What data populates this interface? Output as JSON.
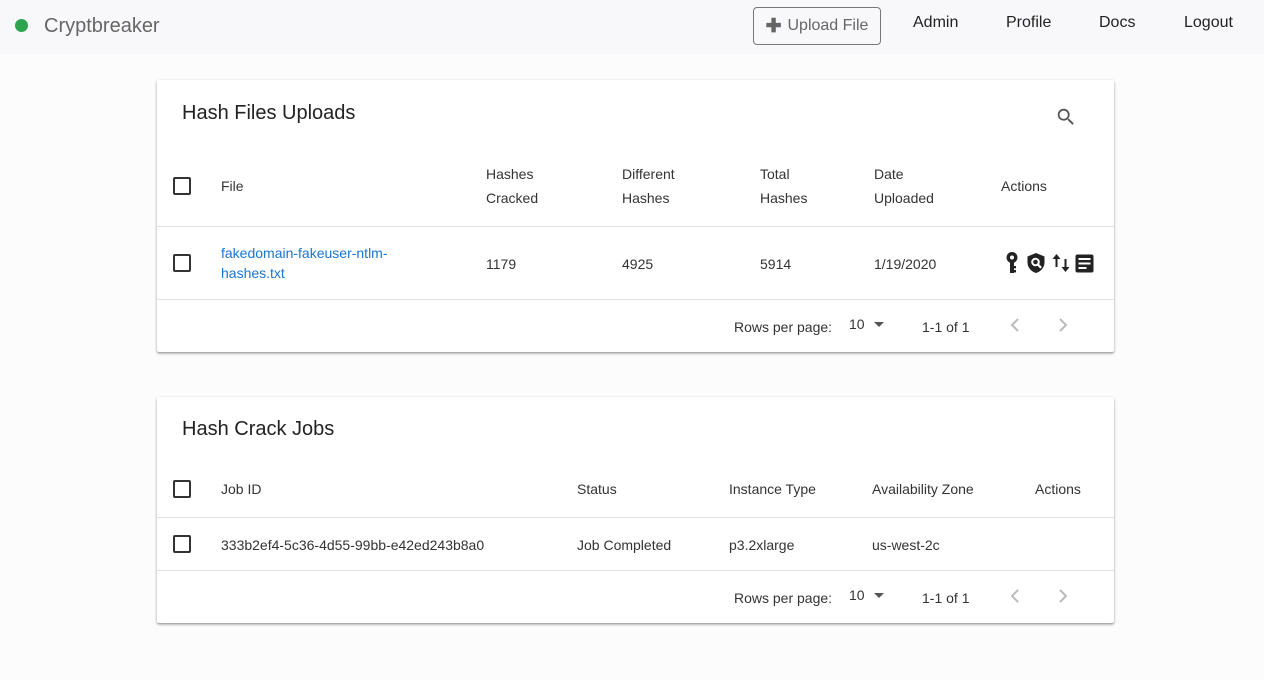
{
  "nav": {
    "brand": "Cryptbreaker",
    "upload_label": "Upload File",
    "links": [
      "Admin",
      "Profile",
      "Docs",
      "Logout"
    ]
  },
  "uploads": {
    "title": "Hash Files Uploads",
    "columns": {
      "file": "File",
      "cracked": [
        "Hashes",
        "Cracked"
      ],
      "different": [
        "Different",
        "Hashes"
      ],
      "total": [
        "Total",
        "Hashes"
      ],
      "date": [
        "Date",
        "Uploaded"
      ],
      "actions": "Actions"
    },
    "row": {
      "file": [
        "fakedomain-fakeuser-ntlm-",
        "hashes.txt"
      ],
      "cracked": "1179",
      "different": "4925",
      "total": "5914",
      "date": "1/19/2020"
    },
    "footer": {
      "rows_label": "Rows per page:",
      "rows_value": "10",
      "range": "1-1 of 1"
    }
  },
  "jobs": {
    "title": "Hash Crack Jobs",
    "columns": {
      "job_id": "Job ID",
      "status": "Status",
      "instance": "Instance Type",
      "zone": "Availability Zone",
      "actions": "Actions"
    },
    "row": {
      "job_id": "333b2ef4-5c36-4d55-99bb-e42ed243b8a0",
      "status": "Job Completed",
      "instance": "p3.2xlarge",
      "zone": "us-west-2c"
    },
    "footer": {
      "rows_label": "Rows per page:",
      "rows_value": "10",
      "range": "1-1 of 1"
    }
  },
  "colors": {
    "brand_dot": "#2ea44f",
    "link": "#1976d2"
  },
  "icons": [
    "plus-icon",
    "search-icon",
    "key-icon",
    "shield-search-icon",
    "swap-vertical-icon",
    "notes-icon",
    "caret-down-icon",
    "chevron-left-icon",
    "chevron-right-icon"
  ]
}
